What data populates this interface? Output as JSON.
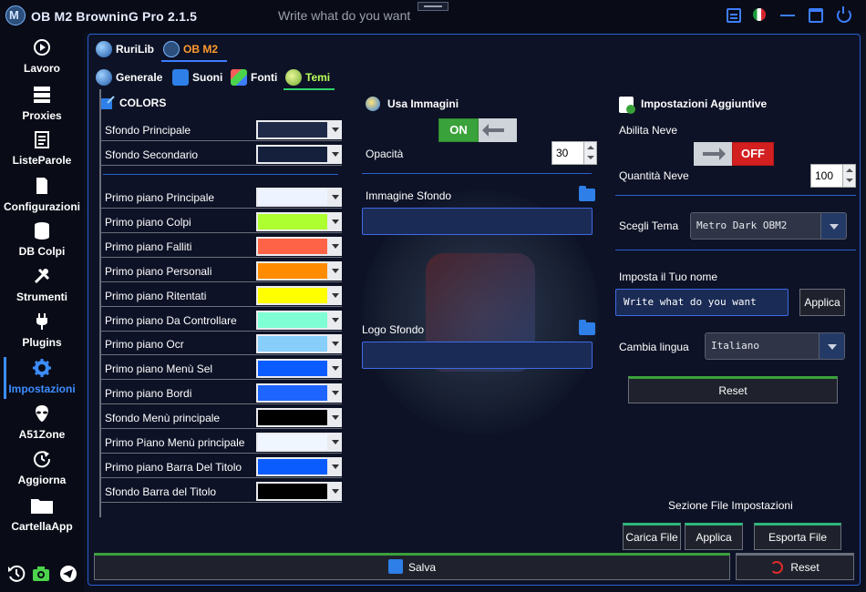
{
  "window": {
    "title": "OB M2 BrowninG Pro  2.1.5",
    "search_placeholder": "Write what do you want",
    "logo_letter": "M"
  },
  "sidebar": {
    "items": [
      {
        "label": "Lavoro",
        "icon": "play-circle-icon"
      },
      {
        "label": "Proxies",
        "icon": "server-icon"
      },
      {
        "label": "ListeParole",
        "icon": "clipboard-list-icon"
      },
      {
        "label": "Configurazioni",
        "icon": "file-icon"
      },
      {
        "label": "DB Colpi",
        "icon": "database-icon"
      },
      {
        "label": "Strumenti",
        "icon": "tools-icon"
      },
      {
        "label": "Plugins",
        "icon": "plug-icon"
      },
      {
        "label": "Impostazioni",
        "icon": "gear-icon",
        "active": true
      },
      {
        "label": "A51Zone",
        "icon": "alien-icon"
      },
      {
        "label": "Aggiorna",
        "icon": "refresh-icon"
      },
      {
        "label": "CartellaApp",
        "icon": "folder-icon"
      }
    ],
    "bottom_icons": [
      "history-icon",
      "camera-icon",
      "telegram-icon"
    ]
  },
  "tabs": {
    "top": [
      {
        "label": "RuriLib",
        "icon": "globe-icon"
      },
      {
        "label": "OB M2",
        "icon": "app-logo-icon",
        "active": true
      }
    ],
    "sub": [
      {
        "label": "Generale",
        "icon": "globe-icon"
      },
      {
        "label": "Suoni",
        "icon": "speaker-icon"
      },
      {
        "label": "Fonti",
        "icon": "shapes-icon"
      },
      {
        "label": "Temi",
        "icon": "palette-icon",
        "active": true
      }
    ]
  },
  "colors": {
    "title": "COLORS",
    "rows": [
      {
        "label": "Sfondo Principale",
        "color": "#1f2a48"
      },
      {
        "label": "Sfondo Secondario",
        "color": "#15203d"
      },
      {
        "label": "Primo piano Principale",
        "color": "#eef4ff"
      },
      {
        "label": "Primo piano Colpi",
        "color": "#adff2f"
      },
      {
        "label": "Primo piano Falliti",
        "color": "#ff6347"
      },
      {
        "label": "Primo piano Personali",
        "color": "#ff8c00"
      },
      {
        "label": "Primo piano Ritentati",
        "color": "#ffff00"
      },
      {
        "label": "Primo piano Da Controllare",
        "color": "#7fffd4"
      },
      {
        "label": "Primo piano Ocr",
        "color": "#87cefa"
      },
      {
        "label": "Primo piano Menù Sel",
        "color": "#0a5cff"
      },
      {
        "label": "Primo piano Bordi",
        "color": "#1e64ff"
      },
      {
        "label": "Sfondo Menù principale",
        "color": "#000000"
      },
      {
        "label": "Primo Piano Menù principale",
        "color": "#f0f6ff"
      },
      {
        "label": "Primo piano Barra Del Titolo",
        "color": "#0a5cff"
      },
      {
        "label": "Sfondo Barra del Titolo",
        "color": "#000000"
      }
    ]
  },
  "middle": {
    "use_images_label": "Usa Immagini",
    "toggle_on_label": "ON",
    "opacity_label": "Opacità",
    "opacity_value": "30",
    "bg_image_label": "Immagine Sfondo",
    "bg_image_value": "",
    "logo_label": "Logo Sfondo",
    "logo_value": ""
  },
  "right": {
    "title": "Impostazioni Aggiuntive",
    "snow_label": "Abilita Neve",
    "toggle_off_label": "OFF",
    "snow_qty_label": "Quantità Neve",
    "snow_qty_value": "100",
    "theme_label": "Scegli Tema",
    "theme_value": "Metro Dark OBM2",
    "name_label": "Imposta il Tuo nome",
    "name_value": "Write what do you want",
    "apply_label": "Applica",
    "lang_label": "Cambia lingua",
    "lang_value": "Italiano",
    "reset_label": "Reset",
    "file_section_label": "Sezione File Impostazioni",
    "load_file_label": "Carica File",
    "apply_file_label": "Applica",
    "export_file_label": "Esporta File"
  },
  "footer": {
    "save_label": "Salva",
    "reset_label": "Reset"
  }
}
